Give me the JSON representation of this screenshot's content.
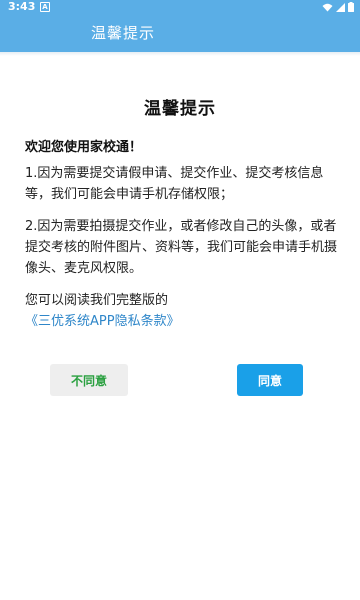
{
  "status_bar": {
    "time": "3:43",
    "notification_letter": "A",
    "icons": [
      "wifi-icon",
      "signal-icon",
      "battery-icon"
    ]
  },
  "app_bar": {
    "title": "温馨提示"
  },
  "dialog": {
    "title": "温馨提示",
    "greeting": "欢迎您使用家校通！",
    "paragraph1": "1.因为需要提交请假申请、提交作业、提交考核信息等，我们可能会申请手机存储权限；",
    "paragraph2": "2.因为需要拍摄提交作业，或者修改自己的头像，或者提交考核的附件图片、资料等，我们可能会申请手机摄像头、麦克风权限。",
    "read_text": "您可以阅读我们完整版的",
    "policy_link": "《三优系统APP隐私条款》",
    "disagree_label": "不同意",
    "agree_label": "同意"
  },
  "colors": {
    "header": "#5aaee6",
    "link": "#2e86c9",
    "agree_button": "#1aa0e8",
    "disagree_text": "#2aa040"
  }
}
